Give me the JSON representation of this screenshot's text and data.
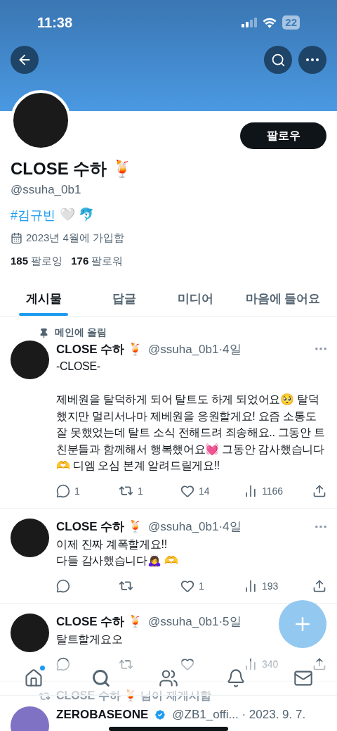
{
  "status_bar": {
    "time": "11:38",
    "battery": "22"
  },
  "profile": {
    "name": "CLOSE 수하 🍹",
    "handle": "@ssuha_0b1",
    "hashtag": "#김규빈",
    "bio_rest": "🤍 🐬",
    "joined": "2023년 4월에 가입함",
    "following_count": "185",
    "following_label": "팔로잉",
    "followers_count": "176",
    "followers_label": "팔로워",
    "follow_button": "팔로우"
  },
  "tabs": [
    {
      "label": "게시물",
      "selected": true
    },
    {
      "label": "답글",
      "selected": false
    },
    {
      "label": "미디어",
      "selected": false
    },
    {
      "label": "마음에 들어요",
      "selected": false
    }
  ],
  "tweets": [
    {
      "pinned_label": "메인에 올림",
      "name": "CLOSE 수하 🍹",
      "meta": "@ssuha_0b1·4일",
      "body": "-CLOSE-\n\n제베원을 탈덕하게 되어 탈트도 하게 되었어요🥺 탈덕했지만 멀리서나마 제베원을 응원할게요! 요즘 소통도 잘 못했었는데 탈트 소식 전해드려 죄송해요.. 그동안 트친분들과 함께해서 행복했어요💓 그동안 감사했습니다🫶 디엠 오심 본계 알려드릴게요!!",
      "replies": "1",
      "reposts": "1",
      "likes": "14",
      "views": "1166"
    },
    {
      "name": "CLOSE 수하 🍹",
      "meta": "@ssuha_0b1·4일",
      "body": "이제 진짜 계폭할게요!!\n다들 감사했습니다🙇‍♀️ 🫶",
      "likes": "1",
      "views": "193"
    },
    {
      "name": "CLOSE 수하 🍹",
      "meta": "@ssuha_0b1·5일",
      "body": "탈트할게요오",
      "views": "340"
    }
  ],
  "repost": {
    "label": "CLOSE 수하 🍹 님이 재게시함",
    "name": "ZEROBASEONE",
    "verified": true,
    "meta": "@ZB1_offi... · 2023. 9. 7."
  },
  "bottom_nav": [
    {
      "kind": "home",
      "dot": true
    },
    {
      "kind": "search",
      "dot": false
    },
    {
      "kind": "communities",
      "dot": false
    },
    {
      "kind": "notifications",
      "dot": false
    },
    {
      "kind": "messages",
      "dot": false
    }
  ]
}
